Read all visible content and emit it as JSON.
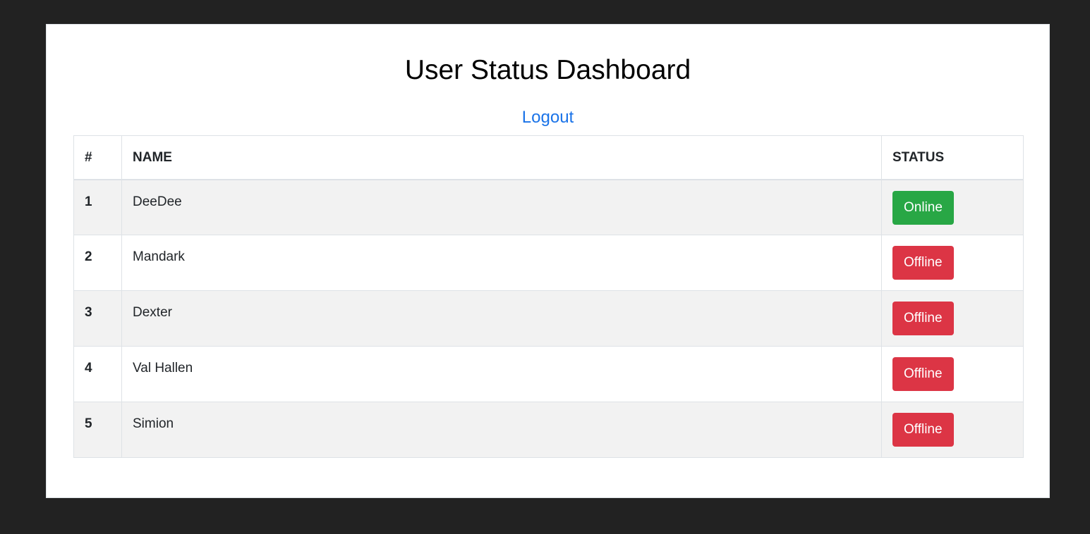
{
  "page": {
    "title": "User Status Dashboard",
    "logout_label": "Logout"
  },
  "table": {
    "headers": {
      "num": "#",
      "name": "NAME",
      "status": "STATUS"
    },
    "rows": [
      {
        "num": "1",
        "name": "DeeDee",
        "status": "Online"
      },
      {
        "num": "2",
        "name": "Mandark",
        "status": "Offline"
      },
      {
        "num": "3",
        "name": "Dexter",
        "status": "Offline"
      },
      {
        "num": "4",
        "name": "Val Hallen",
        "status": "Offline"
      },
      {
        "num": "5",
        "name": "Simion",
        "status": "Offline"
      }
    ]
  },
  "colors": {
    "background": "#222222",
    "link": "#1a73e8",
    "online": "#28a745",
    "offline": "#dc3545",
    "stripe": "#f2f2f2"
  }
}
